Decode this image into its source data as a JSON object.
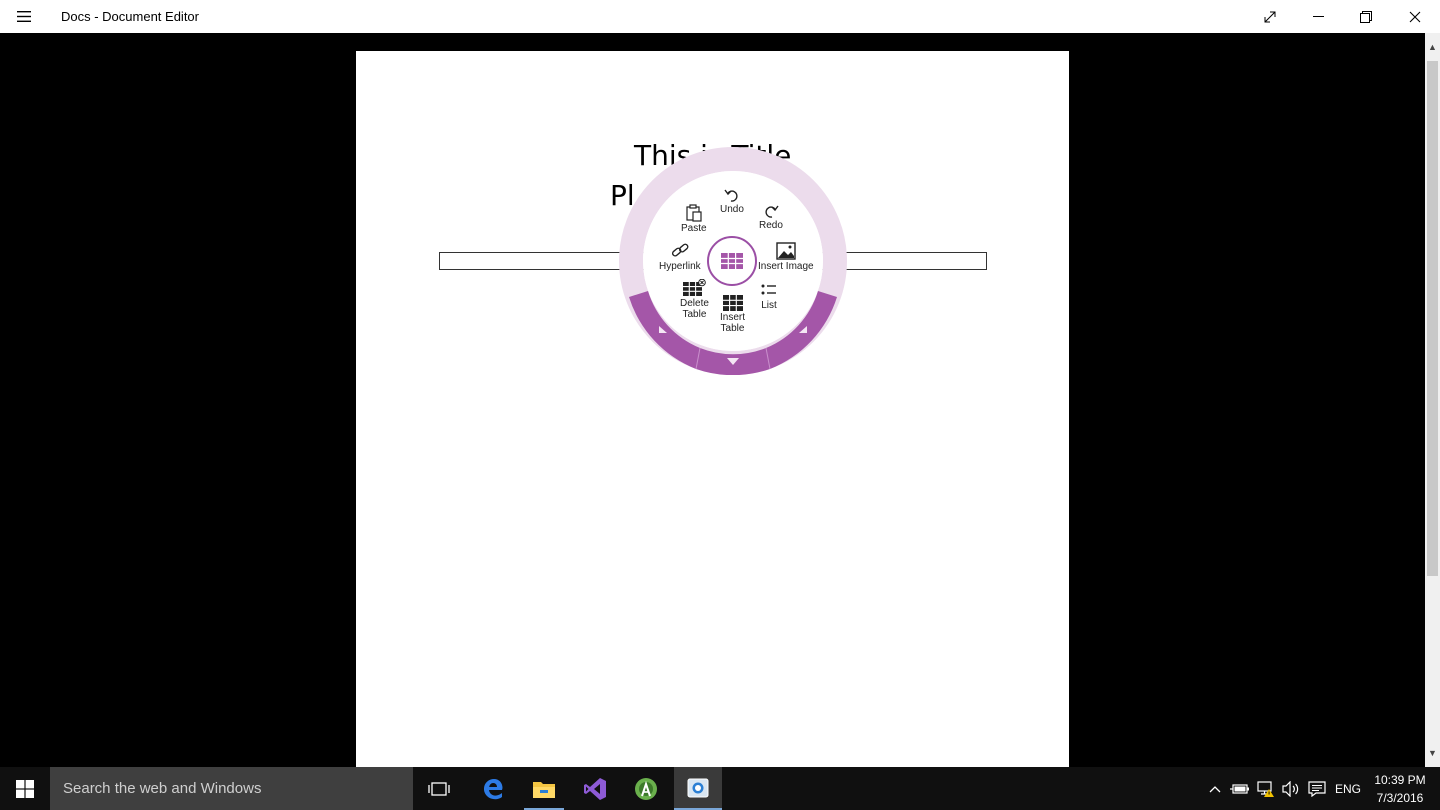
{
  "window": {
    "title": "Docs - Document Editor"
  },
  "document": {
    "title_text": "This is Title",
    "subtitle_text": "Pl"
  },
  "radial_menu": {
    "items": {
      "paste": "Paste",
      "undo": "Undo",
      "redo": "Redo",
      "hyperlink": "Hyperlink",
      "insert_image": "Insert Image",
      "delete_table_1": "Delete",
      "delete_table_2": "Table",
      "list": "List",
      "insert_table_1": "Insert",
      "insert_table_2": "Table"
    },
    "center_icon": "table-icon",
    "accent_color": "#a456a8",
    "ring_color": "#ecdcec"
  },
  "taskbar": {
    "search_placeholder": "Search the web and Windows",
    "language": "ENG",
    "time": "10:39 PM",
    "date": "7/3/2016"
  }
}
